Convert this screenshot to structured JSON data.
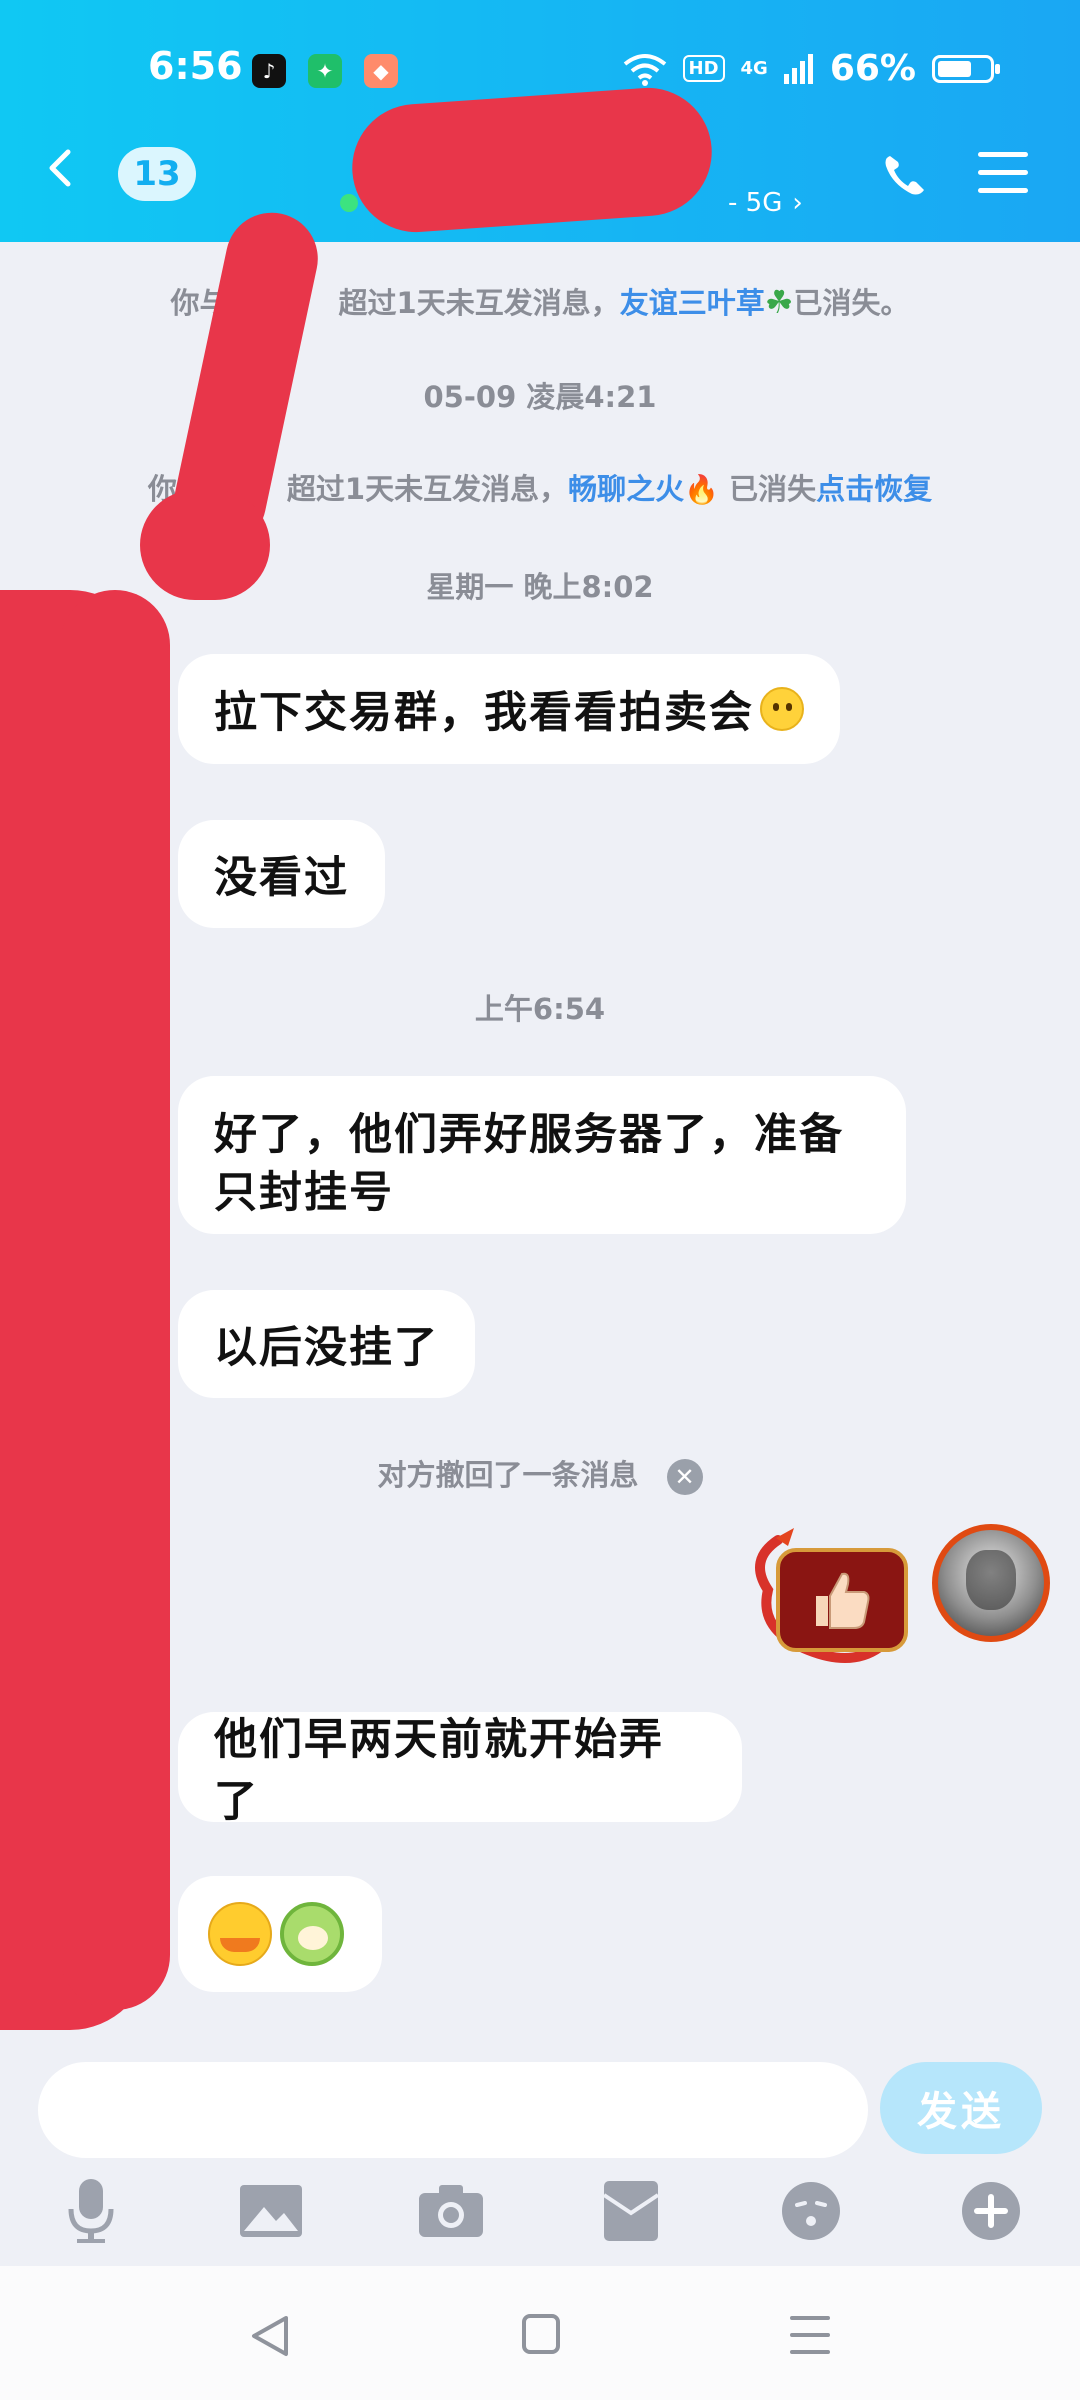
{
  "status_bar": {
    "time": "6:56",
    "network_badge": "HD",
    "network_type": "4G",
    "battery_text": "66%",
    "battery_level": 0.66,
    "apps": [
      "tiktok-icon",
      "wechat-mini-icon",
      "taobao-icon"
    ]
  },
  "header": {
    "unread_count": "13",
    "subtitle_tail": "- 5G",
    "colors": {
      "start": "#10c8f3",
      "end": "#1aa7f3"
    }
  },
  "messages": {
    "sys1_pre": "你与",
    "sys1_mid": "超过1天未互发消息，",
    "sys1_link": "友谊三叶草",
    "sys1_emoji": "☘",
    "sys1_post": "已消失。",
    "time1": "05-09 凌晨4:21",
    "sys2_pre": "你",
    "sys2_mid": "超过1天未互发消息，",
    "sys2_link": "畅聊之火",
    "sys2_emoji": "🔥",
    "sys2_post": "已消失",
    "sys2_action": "点击恢复",
    "time2": "星期一 晚上8:02",
    "msg1": "拉下交易群，我看看拍卖会",
    "msg2": "没看过",
    "time3": "上午6:54",
    "msg3_line1": "好了，他们弄好服务器了，准备",
    "msg3_line2": "只封挂号",
    "msg4": "以后没挂了",
    "recall_notice": "对方撤回了一条消息",
    "msg5": "他们早两天前就开始弄了"
  },
  "input": {
    "send_label": "发送"
  }
}
